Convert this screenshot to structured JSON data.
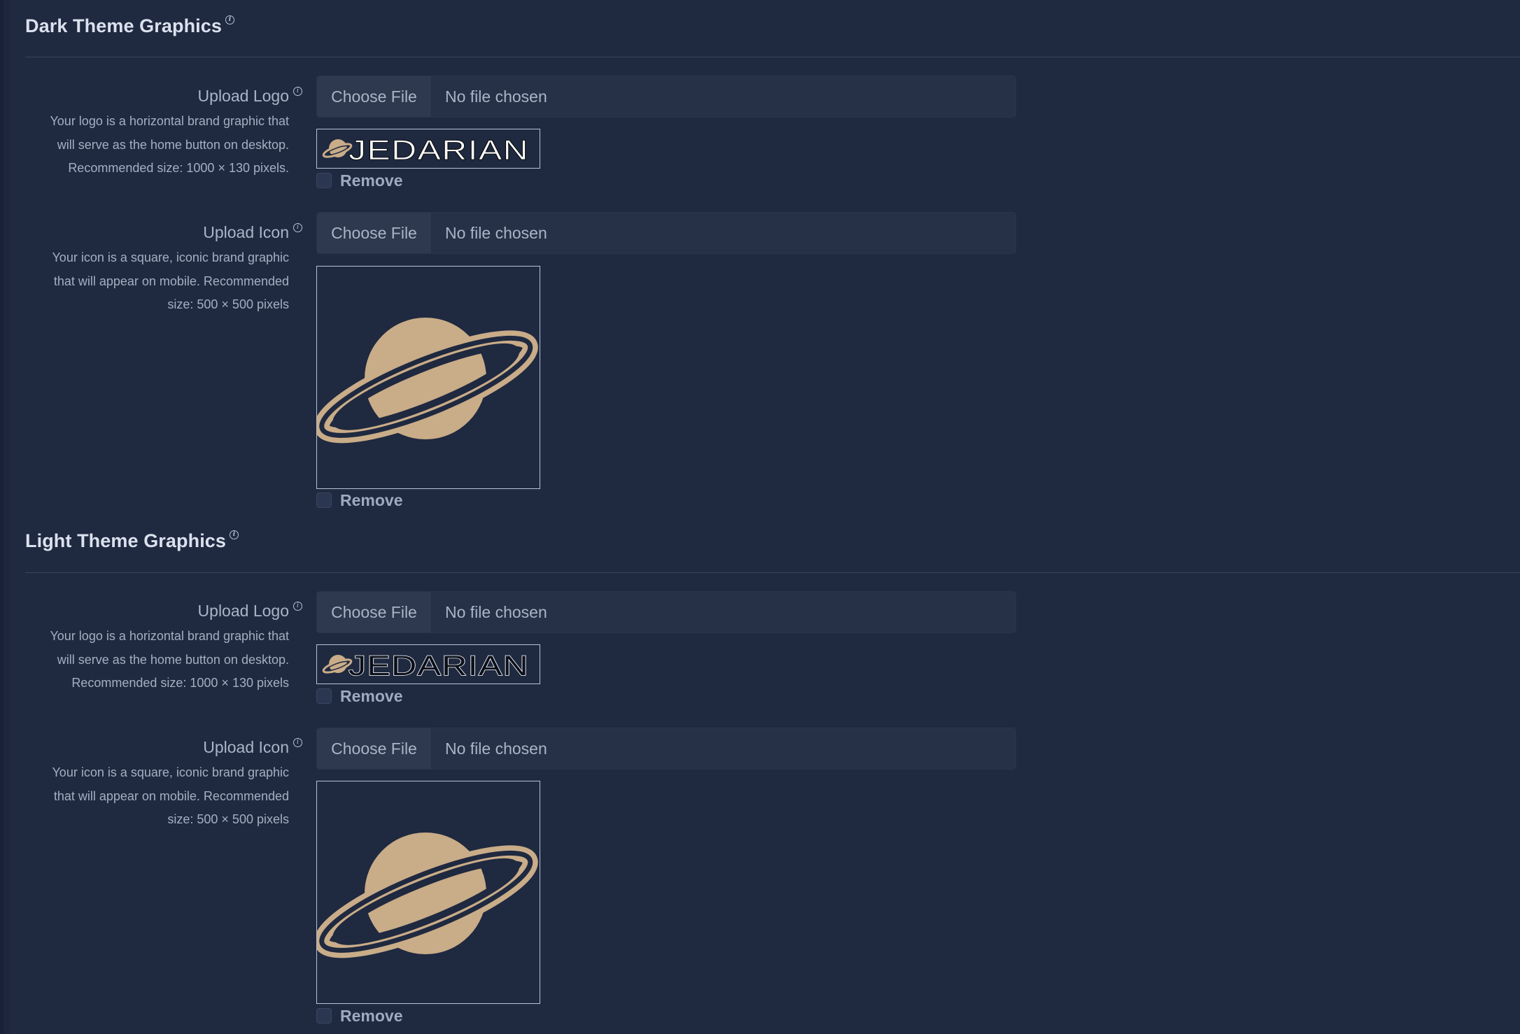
{
  "sections": [
    {
      "title": "Dark Theme Graphics",
      "fields": [
        {
          "label": "Upload Logo",
          "description": [
            "Your logo is a horizontal brand graphic that",
            "will serve as the home button on desktop.",
            "Recommended size: 1000 × 130 pixels."
          ],
          "choose_label": "Choose File",
          "status": "No file chosen",
          "preview_text": "JEDARIAN",
          "remove_label": "Remove"
        },
        {
          "label": "Upload Icon",
          "description": [
            "Your icon is a square, iconic brand graphic",
            "that will appear on mobile. Recommended",
            "size: 500 × 500 pixels"
          ],
          "choose_label": "Choose File",
          "status": "No file chosen",
          "remove_label": "Remove"
        }
      ]
    },
    {
      "title": "Light Theme Graphics",
      "fields": [
        {
          "label": "Upload Logo",
          "description": [
            "Your logo is a horizontal brand graphic that",
            "will serve as the home button on desktop.",
            "Recommended size: 1000 × 130 pixels"
          ],
          "choose_label": "Choose File",
          "status": "No file chosen",
          "preview_text": "JEDARIAN",
          "remove_label": "Remove"
        },
        {
          "label": "Upload Icon",
          "description": [
            "Your icon is a square, iconic brand graphic",
            "that will appear on mobile. Recommended",
            "size: 500 × 500 pixels"
          ],
          "choose_label": "Choose File",
          "status": "No file chosen",
          "remove_label": "Remove"
        }
      ]
    }
  ],
  "colors": {
    "background": "#1f2940",
    "brand_tan": "#c9ac88",
    "heading": "#dbe2ee",
    "label": "#aab5c9"
  },
  "icons": {
    "info": "info-circle-icon",
    "planet": "saturn-planet-icon"
  }
}
